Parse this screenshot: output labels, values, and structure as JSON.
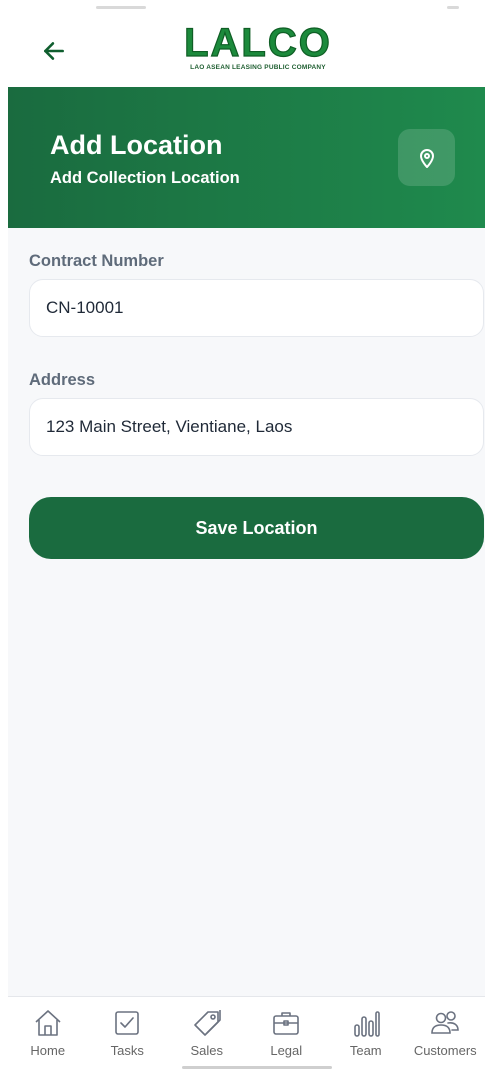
{
  "header": {
    "logo_text": "LALCO",
    "logo_subtitle": "LAO ASEAN LEASING PUBLIC COMPANY",
    "back_icon": "arrow-left-icon"
  },
  "hero": {
    "title": "Add Location",
    "subtitle": "Add Collection Location",
    "icon": "map-pin-icon"
  },
  "form": {
    "contract_label": "Contract Number",
    "contract_value": "CN-10001",
    "address_label": "Address",
    "address_value": "123 Main Street, Vientiane, Laos",
    "save_label": "Save Location"
  },
  "nav": {
    "items": [
      {
        "label": "Home",
        "icon": "home-icon"
      },
      {
        "label": "Tasks",
        "icon": "checkbox-icon"
      },
      {
        "label": "Sales",
        "icon": "tag-icon"
      },
      {
        "label": "Legal",
        "icon": "briefcase-icon"
      },
      {
        "label": "Team",
        "icon": "bar-chart-icon"
      },
      {
        "label": "Customers",
        "icon": "users-icon"
      }
    ]
  },
  "colors": {
    "brand_green": "#1a6b3f",
    "hero_gradient_end": "#1f8a4d",
    "background": "#f7f8fa"
  }
}
